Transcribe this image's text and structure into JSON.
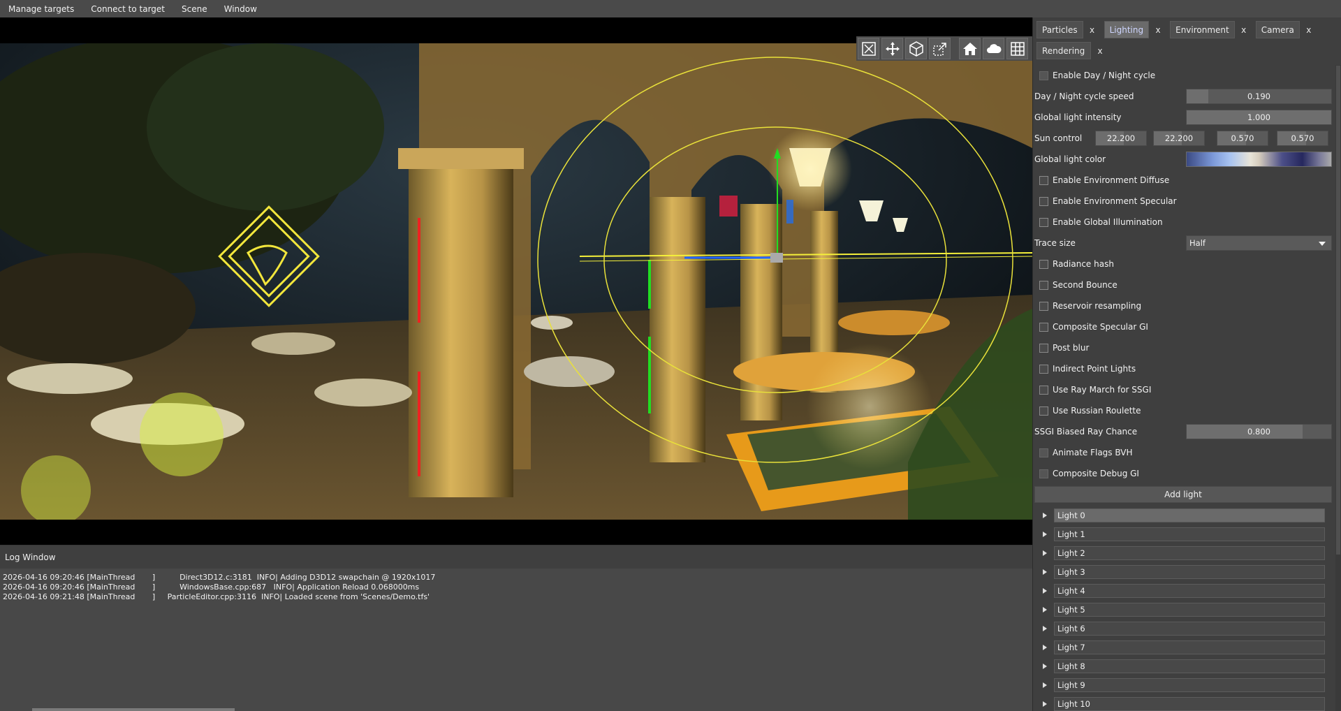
{
  "menu": {
    "items": [
      "Manage targets",
      "Connect to target",
      "Scene",
      "Window"
    ]
  },
  "toolbar": {
    "buttons": [
      "close-icon",
      "move-icon",
      "cube-icon",
      "scale-icon",
      "home-icon",
      "cloud-icon",
      "grid-icon"
    ]
  },
  "tabs": [
    {
      "label": "Particles",
      "close": "x",
      "active": false
    },
    {
      "label": "Lighting",
      "close": "x",
      "active": true
    },
    {
      "label": "Environment",
      "close": "x",
      "active": false
    },
    {
      "label": "Camera",
      "close": "x",
      "active": false
    },
    {
      "label": "Rendering",
      "close": "x",
      "active": false
    }
  ],
  "lighting": {
    "enable_day_night": {
      "label": "Enable Day / Night cycle",
      "checked": false
    },
    "day_night_speed": {
      "label": "Day / Night cycle speed",
      "value": "0.190",
      "fraction": 0.15
    },
    "global_intensity": {
      "label": "Global light intensity",
      "value": "1.000",
      "fraction": 1.0
    },
    "sun_control": {
      "label": "Sun control",
      "values": [
        "22.200",
        "22.200",
        "0.570",
        "0.570"
      ],
      "fractions": [
        0.55,
        0.55,
        0.57,
        0.57
      ]
    },
    "global_color": {
      "label": "Global light color"
    },
    "env_diffuse": {
      "label": "Enable Environment Diffuse",
      "checked": false
    },
    "env_specular": {
      "label": "Enable Environment Specular",
      "checked": false
    },
    "global_illum": {
      "label": "Enable Global Illumination",
      "checked": false
    },
    "trace_size": {
      "label": "Trace size",
      "value": "Half"
    },
    "radiance_hash": {
      "label": "Radiance hash",
      "checked": false
    },
    "second_bounce": {
      "label": "Second Bounce",
      "checked": false
    },
    "reservoir": {
      "label": "Reservoir resampling",
      "checked": false
    },
    "composite_spec_gi": {
      "label": "Composite Specular GI",
      "checked": false
    },
    "post_blur": {
      "label": "Post blur",
      "checked": false
    },
    "indirect_point": {
      "label": "Indirect Point Lights",
      "checked": false
    },
    "ray_march": {
      "label": "Use Ray March for SSGI",
      "checked": false
    },
    "russian_roulette": {
      "label": "Use Russian Roulette",
      "checked": false
    },
    "ssgi_biased": {
      "label": "SSGI Biased Ray Chance",
      "value": "0.800",
      "fraction": 0.8
    },
    "animate_flags": {
      "label": "Animate Flags BVH",
      "checked": false
    },
    "composite_debug": {
      "label": "Composite Debug GI",
      "checked": false
    },
    "add_light": "Add light",
    "lights": [
      "Light 0",
      "Light 1",
      "Light 2",
      "Light 3",
      "Light 4",
      "Light 5",
      "Light 6",
      "Light 7",
      "Light 8",
      "Light 9",
      "Light 10"
    ]
  },
  "log": {
    "title": "Log Window",
    "lines": [
      "2026-04-16 09:20:46 [MainThread       ]          Direct3D12.c:3181  INFO| Adding D3D12 swapchain @ 1920x1017",
      "2026-04-16 09:20:46 [MainThread       ]          WindowsBase.cpp:687   INFO| Application Reload 0.068000ms",
      "2026-04-16 09:21:48 [MainThread       ]     ParticleEditor.cpp:3116  INFO| Loaded scene from 'Scenes/Demo.tfs'"
    ]
  }
}
